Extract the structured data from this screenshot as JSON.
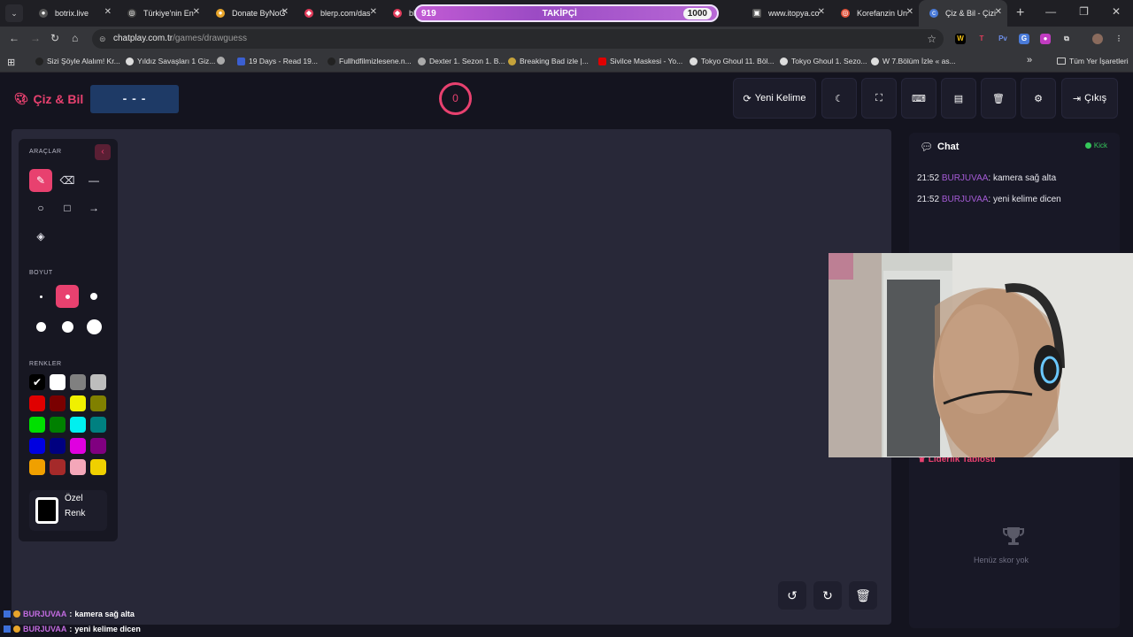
{
  "browser": {
    "tabs": [
      {
        "title": "botrix.live",
        "favicon_color": "#ffffff"
      },
      {
        "title": "Türkiye'nin En",
        "favicon_color": "#ffffff"
      },
      {
        "title": "Donate ByNoG",
        "favicon_color": "#e8a52b"
      },
      {
        "title": "blerp.com/das",
        "favicon_color": "#e23c5b"
      },
      {
        "title": "blerp",
        "favicon_color": "#e23c5b"
      },
      {
        "title": "www.itopya.co",
        "favicon_color": "#ffffff"
      },
      {
        "title": "Korefanzin Un",
        "favicon_color": "#e0523a"
      },
      {
        "title": "Çiz & Bil - Çizi",
        "favicon_color": "#4a7bd9"
      }
    ],
    "url_host": "chatplay.com.tr",
    "url_path": "/games/drawguess",
    "bookmarks": [
      "Sizi Şöyle Alalım! Kr...",
      "Yıldız Savaşları 1 Giz...",
      "19 Days - Read 19...",
      "Fullhdfilmizlesene.n...",
      "Dexter 1. Sezon 1. B...",
      "Breaking Bad izle |...",
      "Sivilce Maskesi - Yo...",
      "Tokyo Ghoul 11. Böl...",
      "Tokyo Ghoul 1. Sezo...",
      "W 7.Bölüm İzle « as..."
    ],
    "bookmarks_all": "Tüm Yer İşaretleri"
  },
  "overlay": {
    "follower_current": "919",
    "follower_label": "TAKİPÇİ",
    "follower_goal": "1000",
    "follower_progress": 0.919
  },
  "app": {
    "logo": "Çiz & Bil",
    "word": "- - -",
    "timer": "0",
    "new_word": "Yeni Kelime",
    "logout": "Çıkış",
    "accent": "#e8416f"
  },
  "tools": {
    "tools_label": "ARAÇLAR",
    "size_label": "BOYUT",
    "colors_label": "RENKLER",
    "custom_color_line1": "Özel",
    "custom_color_line2": "Renk",
    "colors": [
      "#000000",
      "#ffffff",
      "#808080",
      "#bdbdbd",
      "#e00000",
      "#7a0000",
      "#f0f000",
      "#808000",
      "#00e000",
      "#008000",
      "#00f0f0",
      "#008080",
      "#0000e0",
      "#000080",
      "#e000e0",
      "#800080",
      "#f0a000",
      "#a52a2a",
      "#f4a7b9",
      "#f0d000"
    ]
  },
  "chat": {
    "title": "Chat",
    "status": "Kick",
    "messages": [
      {
        "time": "21:52",
        "user": "BURJUVAA",
        "text": "kamera sağ alta"
      },
      {
        "time": "21:52",
        "user": "BURJUVAA",
        "text": "yeni kelime dicen"
      }
    ]
  },
  "leaderboard": {
    "title": "Liderlik Tablosu",
    "empty": "Henüz skor yok"
  },
  "overlay_chat": [
    {
      "user": "BURJUVAA",
      "text": "kamera sağ alta"
    },
    {
      "user": "BURJUVAA",
      "text": "yeni kelime dicen"
    }
  ]
}
